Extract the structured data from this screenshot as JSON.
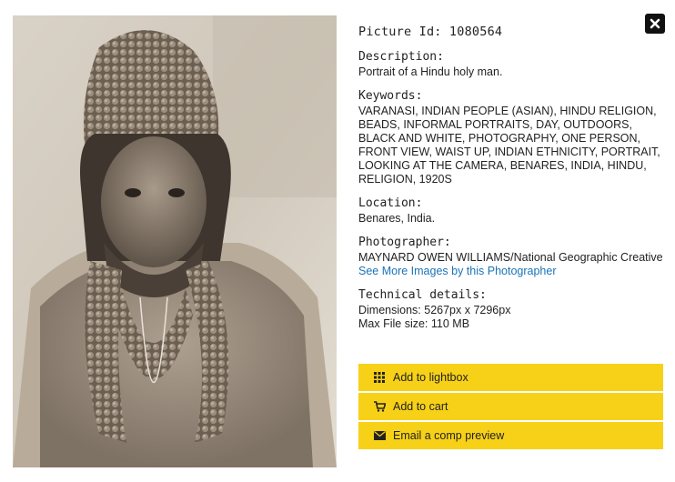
{
  "photo": {
    "alt": "Portrait of a Hindu holy man."
  },
  "details": {
    "picture_id": "Picture Id: 1080564",
    "description_label": "Description:",
    "description": "Portrait of a Hindu holy man.",
    "keywords_label": "Keywords:",
    "keywords": "VARANASI, INDIAN PEOPLE (ASIAN), HINDU RELIGION, BEADS, INFORMAL PORTRAITS, DAY, OUTDOORS, BLACK AND WHITE, PHOTOGRAPHY, ONE PERSON, FRONT VIEW, WAIST UP, INDIAN ETHNICITY, PORTRAIT, LOOKING AT THE CAMERA, BENARES, INDIA, HINDU, RELIGION, 1920S",
    "location_label": "Location:",
    "location": "Benares, India.",
    "photographer_label": "Photographer:",
    "photographer": "MAYNARD OWEN WILLIAMS/National Geographic Creative",
    "photographer_link": "See More Images by this Photographer",
    "technical_label": "Technical details:",
    "dimensions": "Dimensions: 5267px x 7296px",
    "max_file_size": "Max File size: 110 MB"
  },
  "actions": {
    "lightbox": {
      "label": "Add to lightbox",
      "icon": "grid-icon"
    },
    "cart": {
      "label": "Add to cart",
      "icon": "cart-icon"
    },
    "email": {
      "label": "Email a comp preview",
      "icon": "envelope-icon"
    }
  },
  "close": {
    "icon": "close-icon"
  },
  "colors": {
    "button_bg": "#f7d117",
    "link": "#1a73b8",
    "close_bg": "#111111"
  }
}
